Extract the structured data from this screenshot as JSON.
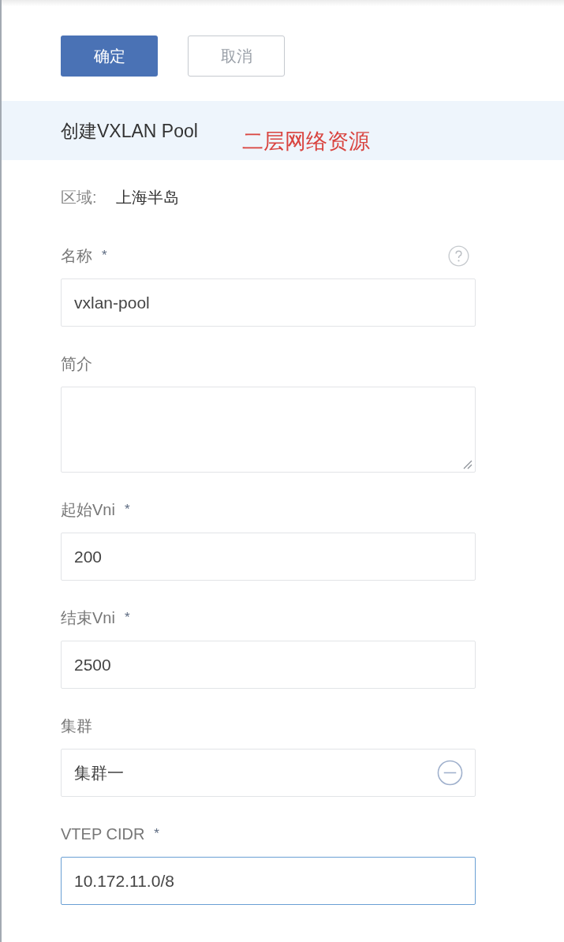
{
  "actions": [
    {
      "label": "确定",
      "kind": "primary"
    },
    {
      "label": "取消",
      "kind": "secondary"
    }
  ],
  "header": {
    "title": "创建VXLAN Pool",
    "annotation": "二层网络资源"
  },
  "zone": {
    "label": "区域:",
    "value": "上海半岛"
  },
  "fields": [
    {
      "kind": "input",
      "label": "名称",
      "required_mark": "*",
      "help": true,
      "value": "vxlan-pool",
      "focused": false
    },
    {
      "kind": "textarea",
      "label": "简介",
      "focused": false
    },
    {
      "kind": "input",
      "label": "起始Vni",
      "required_mark": "*",
      "value": "200",
      "focused": false
    },
    {
      "kind": "input",
      "label": "结束Vni",
      "required_mark": "*",
      "value": "2500",
      "focused": false
    },
    {
      "kind": "select",
      "label": "集群",
      "value": "集群一",
      "focused": false
    },
    {
      "kind": "input",
      "label": "VTEP CIDR",
      "required_mark": "*",
      "value": "10.172.11.0/8",
      "focused": true
    }
  ]
}
